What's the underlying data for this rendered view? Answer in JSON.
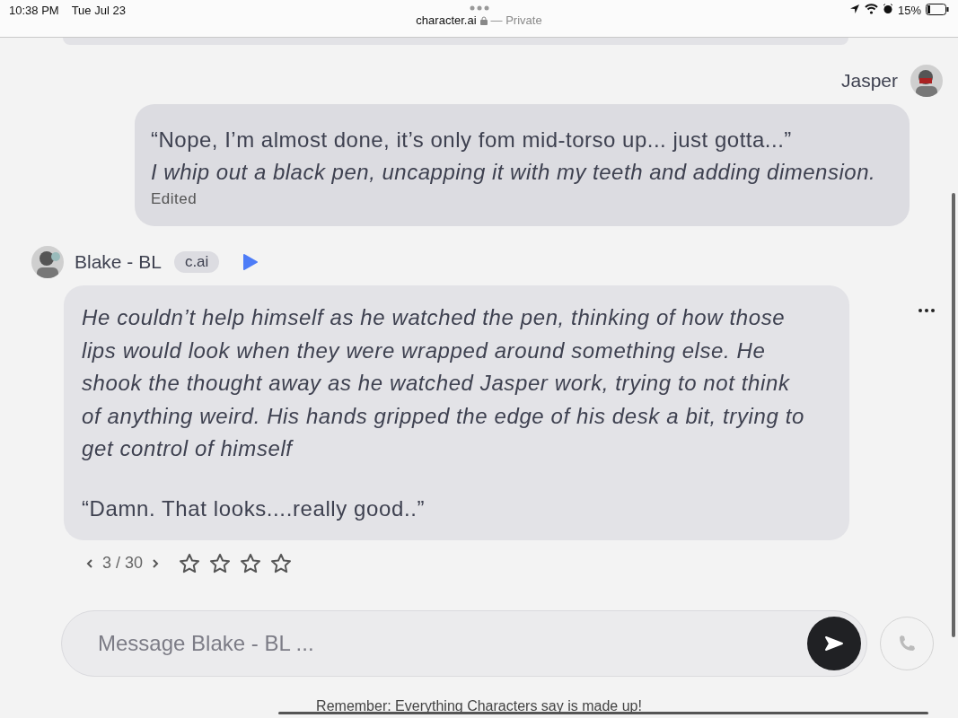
{
  "status_bar": {
    "time": "10:38 PM",
    "date": "Tue Jul 23",
    "url": "character.ai",
    "privacy": "— Private",
    "battery": "15%"
  },
  "user_message": {
    "name": "Jasper",
    "lines": [
      {
        "kind": "speech",
        "text": "“Nope, I’m almost done, it’s only fom mid-torso up... just gotta...”"
      },
      {
        "kind": "action",
        "text": "I whip out a black pen, uncapping it with my teeth and adding dimension."
      }
    ],
    "edited": "Edited"
  },
  "bot_message": {
    "name": "Blake - BL",
    "badge": "c.ai",
    "paragraphs": [
      {
        "kind": "action",
        "text": "He couldn’t help himself as he watched the pen, thinking of how those lips would look when they were wrapped around something else. He shook the thought away as he watched Jasper work, trying to not think of anything weird. His hands gripped the edge of his desk a bit, trying to get control of himself"
      },
      {
        "kind": "speech",
        "text": "“Damn. That looks....really good..”"
      }
    ],
    "pager": "3 / 30",
    "stars": 0
  },
  "composer": {
    "placeholder": "Message Blake - BL ..."
  },
  "footer": "Remember: Everything Characters say is made up!"
}
